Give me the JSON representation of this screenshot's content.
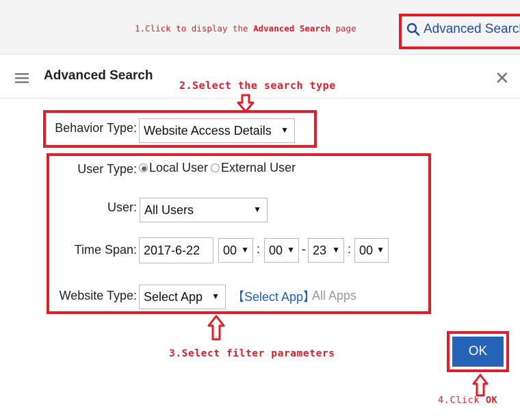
{
  "annotations": {
    "step1_prefix": "1.Click to display the ",
    "step1_bold": "Advanced Search",
    "step1_suffix": " page",
    "step2": "2.Select the search type",
    "step3": "3.Select filter parameters",
    "step4_prefix": "4.Click ",
    "step4_bold": "OK"
  },
  "topbar": {
    "advanced_search_link": "Advanced Search",
    "icon": "search-icon"
  },
  "panel": {
    "title": "Advanced Search",
    "menu_icon": "menu-icon",
    "close_icon": "close-icon"
  },
  "form": {
    "behavior_type": {
      "label": "Behavior Type:",
      "value": "Website Access Details"
    },
    "user_type": {
      "label": "User Type:",
      "options": [
        "Local User",
        "External User"
      ],
      "selected": "Local User"
    },
    "user": {
      "label": "User:",
      "value": "All Users"
    },
    "time_span": {
      "label": "Time Span:",
      "date": "2017-6-22",
      "start_hour": "00",
      "start_min": "00",
      "end_hour": "23",
      "end_min": "00",
      "colon": ":",
      "dash": "-"
    },
    "website_type": {
      "label": "Website Type:",
      "value": "Select App",
      "select_link": "【Select App】",
      "current": "All Apps"
    }
  },
  "ok_button": "OK",
  "colors": {
    "highlight": "#e01e2a",
    "primary": "#2563b6",
    "link": "#1f5fbf"
  }
}
